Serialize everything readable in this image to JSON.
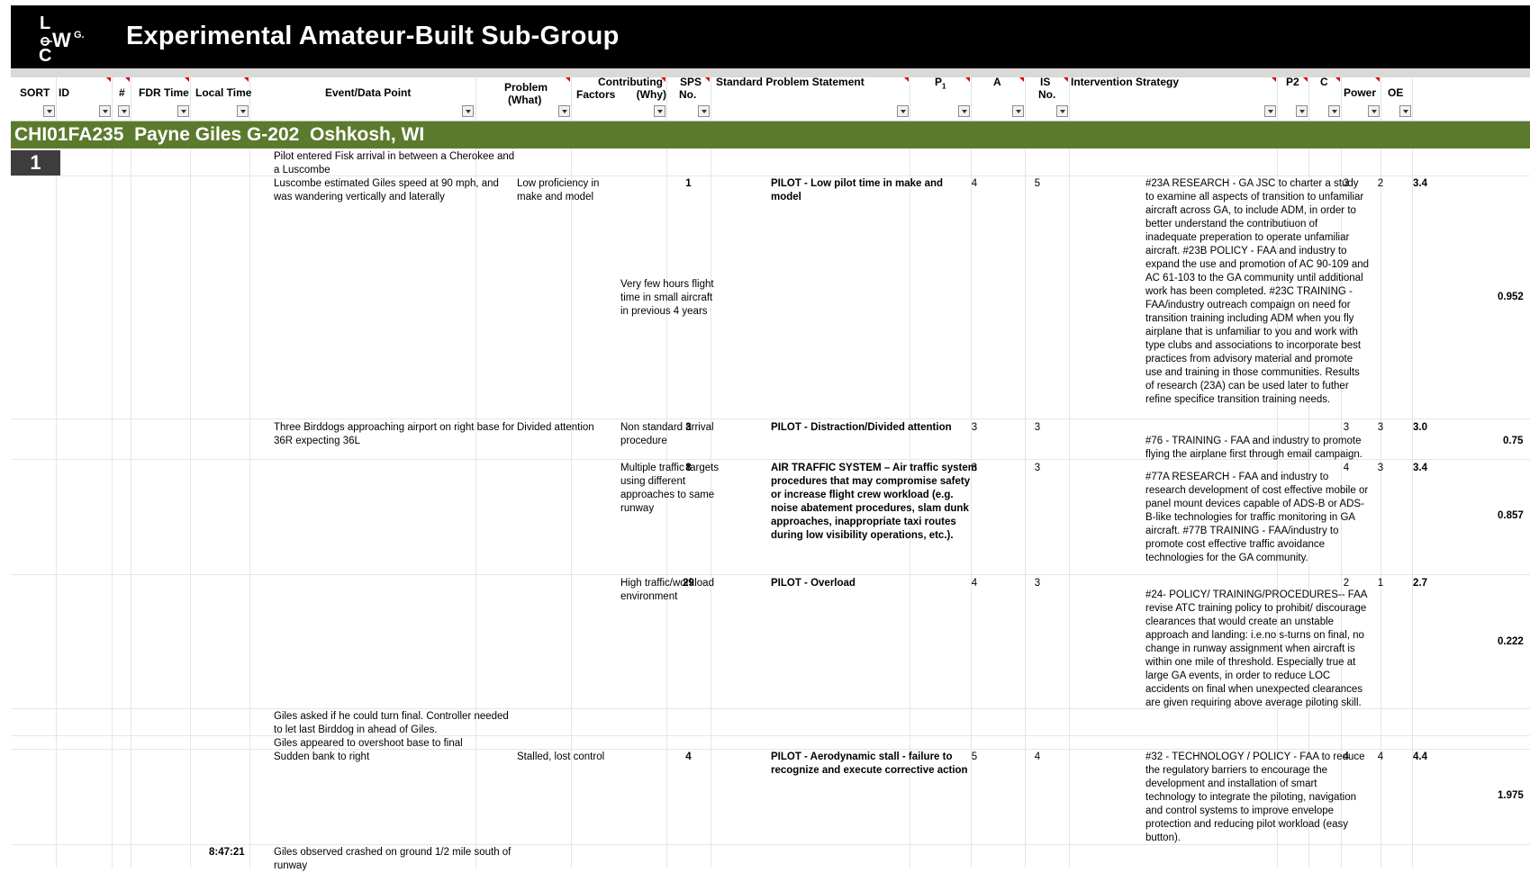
{
  "header": {
    "logo_text": "LOCWG",
    "title": "Experimental Amateur-Built Sub-Group"
  },
  "columns": {
    "sort": "SORT",
    "id": "ID",
    "num": "#",
    "fdr_time": "FDR Time",
    "local_time": "Local Time",
    "event": "Event/Data Point",
    "problem_1": "Problem",
    "problem_2": "(What)",
    "contrib_1": "Contributing",
    "contrib_2": "Factors       (Why)",
    "sps_1": "SPS",
    "sps_2": "No.",
    "statement": "Standard Problem Statement",
    "p1": "P",
    "p1_sub": "1",
    "a": "A",
    "is_1": "IS",
    "is_2": "No.",
    "intervention": "Intervention Strategy",
    "p2": "P2",
    "c": "C",
    "power": "Power",
    "oe": "OE"
  },
  "event_header": "CHI01FA235  Payne Giles G-202  Oshkosh, WI",
  "sort_number": "1",
  "rows": {
    "r1_event": "Pilot entered Fisk arrival in between a Cherokee and\na Luscombe",
    "r2_event": "Luscombe estimated Giles speed at 90 mph, and\nwas wandering vertically and laterally",
    "r2_problem": "Low proficiency in\nmake and model",
    "r2_contrib": "Very few hours flight\ntime in small aircraft\nin previous 4 years",
    "r2_sps": "1",
    "r2_statement": "PILOT - Low pilot time in make and\nmodel",
    "r2_p1": "4",
    "r2_a": "5",
    "r2_intervention": "#23A RESEARCH - GA JSC to charter a study\nto examine all aspects of transition to unfamiliar\naircraft across GA, to include ADM, in order to\nbetter understand the contributiuon of\ninadequate preperation to operate unfamiliar\naircraft.  #23B POLICY - FAA and industry to\nexpand the use and promotion of AC 90-109 and\nAC 61-103 to the GA community until additional\nwork has been completed.  #23C TRAINING -\nFAA/industry outreach compaign on need for\ntransition training including ADM when you fly\nairplane that is unfamiliar to you and work with\ntype clubs and associations to incorporate best\npractices from advisory material and promote\nuse and training in those communities.  Results\nof research (23A) can be used later to futher\nrefine specifice transition training needs.",
    "r2_p2": "3",
    "r2_c": "2",
    "r2_power": "3.4",
    "r2_oe": "0.952",
    "r3_event": "Three Birddogs approaching airport on right base for\n36R expecting 36L",
    "r3_problem": "Divided attention",
    "r3_contrib": "Non standard arrival\nprocedure",
    "r3_sps": "3",
    "r3_statement": "PILOT - Distraction/Divided attention",
    "r3_p1": "3",
    "r3_a": "3",
    "r3_intervention": "#76 - TRAINING - FAA and industry to promote\nflying the airplane first through email campaign.",
    "r3_p2": "3",
    "r3_c": "3",
    "r3_power": "3.0",
    "r3_oe": "0.75",
    "r4_contrib": "Multiple traffic targets\nusing different\napproaches to same\nrunway",
    "r4_sps": "8",
    "r4_statement": "AIR TRAFFIC SYSTEM – Air traffic system\nprocedures that may compromise safety\nor increase flight crew workload (e.g.\nnoise abatement procedures, slam dunk\napproaches, inappropriate taxi routes\nduring low visibility operations, etc.).",
    "r4_p1": "3",
    "r4_a": "3",
    "r4_intervention": "#77A RESEARCH - FAA and industry to\nresearch development of cost effective mobile or\npanel mount devices capable of ADS-B or ADS-\nB-like technologies for traffic monitoring in GA\naircraft. #77B TRAINING - FAA/industry to\npromote cost effective traffic avoidance\ntechnologies for the GA community.",
    "r4_p2": "4",
    "r4_c": "3",
    "r4_power": "3.4",
    "r4_oe": "0.857",
    "r5_contrib": "High traffic/workload\nenvironment",
    "r5_sps": "29",
    "r5_statement": "PILOT - Overload",
    "r5_p1": "4",
    "r5_a": "3",
    "r5_intervention": "#24- POLICY/ TRAINING/PROCEDURES-- FAA\nrevise ATC training policy to prohibit/ discourage\nclearances that would create an unstable\napproach and landing: i.e.no s-turns on final, no\nchange in runway assignment when aircraft is\nwithin one mile of threshold. Especially true at\nlarge GA events, in order to reduce LOC\naccidents on final when unexpected clearances\nare given requiring above average piloting skill.",
    "r5_p2": "2",
    "r5_c": "1",
    "r5_power": "2.7",
    "r5_oe": "0.222",
    "r6_event": "Giles asked if he could turn final.  Controller needed\nto let last Birddog in ahead of Giles.",
    "r7_event": "Giles appeared to overshoot base to final",
    "r8_event": "Sudden bank to right",
    "r8_problem": "Stalled, lost control",
    "r8_sps": "4",
    "r8_statement": "PILOT - Aerodynamic stall - failure to\nrecognize and execute corrective action",
    "r8_p1": "5",
    "r8_a": "4",
    "r8_intervention": "#32 - TECHNOLOGY / POLICY - FAA to reduce\nthe regulatory barriers to encourage the\ndevelopment and installation of smart\ntechnology to integrate the piloting, navigation\nand control systems to improve envelope\nprotection and reducing pilot workload (easy\nbutton).",
    "r8_p2": "4",
    "r8_c": "4",
    "r8_power": "4.4",
    "r8_oe": "1.975",
    "r9_time": "8:47:21",
    "r9_event": "Giles observed crashed on ground 1/2 mile south of\nrunway"
  }
}
